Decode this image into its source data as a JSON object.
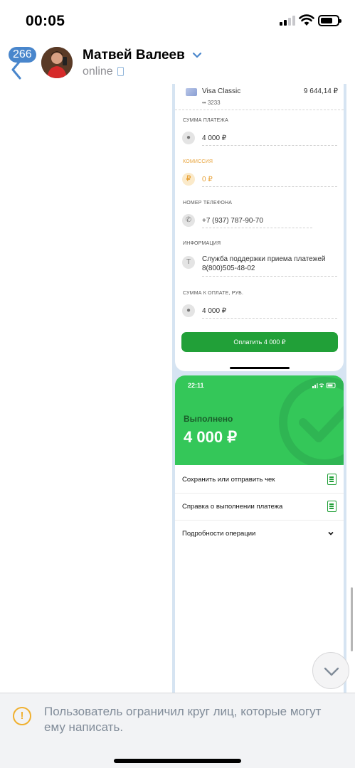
{
  "status_bar": {
    "time": "00:05"
  },
  "header": {
    "unread_count": "266",
    "contact_name": "Матвей Валеев",
    "status": "online"
  },
  "receipt_form": {
    "card": {
      "name": "Visa Classic",
      "balance": "9 644,14 ₽",
      "number": "•• 3233"
    },
    "fields": [
      {
        "label": "СУММА ПЛАТЕЖА",
        "value": "4 000 ₽",
        "icon": "wallet-icon"
      },
      {
        "label": "КОМИССИЯ",
        "value": "0 ₽",
        "icon": "ruble-icon"
      },
      {
        "label": "НОМЕР ТЕЛЕФОНА",
        "value": "+7 (937) 787-90-70",
        "icon": "phone-icon"
      },
      {
        "label": "ИНФОРМАЦИЯ",
        "value": "Служба поддержки приема платежей 8(800)505-48-02",
        "icon": "info-icon"
      },
      {
        "label": "СУММА К ОПЛАТЕ, РУБ.",
        "value": "4 000 ₽",
        "icon": "wallet-icon"
      }
    ],
    "pay_button": "Оплатить 4 000 ₽"
  },
  "result_screen": {
    "time": "22:11",
    "status": "Выполнено",
    "amount": "4 000 ₽",
    "rows": [
      {
        "label": "Сохранить или отправить чек",
        "icon": "document-icon"
      },
      {
        "label": "Справка о выполнении платежа",
        "icon": "document-icon"
      },
      {
        "label": "Подробности операции",
        "icon": "chevron-down-icon"
      }
    ]
  },
  "restriction": {
    "text": "Пользователь ограничил круг лиц, которые могут ему написать."
  },
  "colors": {
    "accent": "#4986cc",
    "sber_green": "#21a038",
    "success_green": "#34c759",
    "warning": "#f0b02f"
  }
}
